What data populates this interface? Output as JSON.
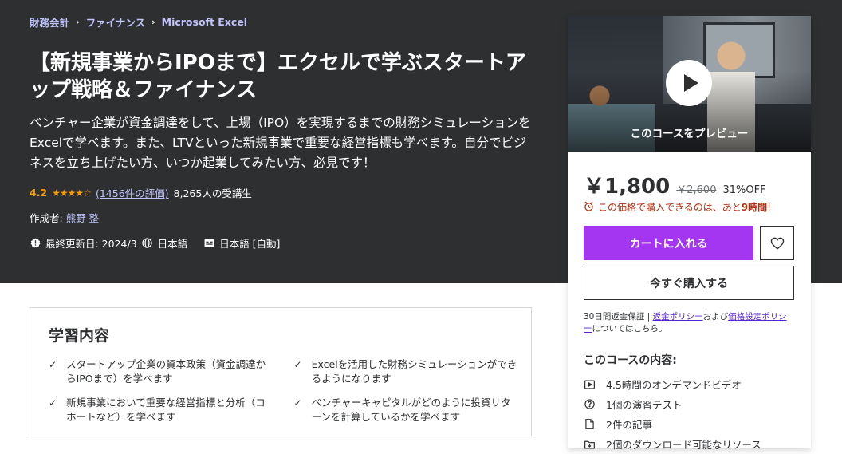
{
  "breadcrumb": [
    "財務会計",
    "ファイナンス",
    "Microsoft Excel"
  ],
  "course": {
    "title": "【新規事業からIPOまで】エクセルで学ぶスタートアップ戦略＆ファイナンス",
    "subtitle": "ベンチャー企業が資金調達をして、上場（IPO）を実現するまでの財務シミュレーションをExcelで学べます。また、LTVといった新規事業で重要な経営指標も学べます。自分でビジネスを立ち上げたい方、いつか起業してみたい方、必見です！",
    "rating": "4.2",
    "stars": "★★★★☆",
    "rating_count": "(1456件の評価)",
    "students": "8,265人の受講生",
    "author_label": "作成者:",
    "author": "熊野 整",
    "last_updated": "最終更新日: 2024/3",
    "language": "日本語",
    "captions": "日本語 [自動]"
  },
  "learn": {
    "title": "学習内容",
    "items": [
      "スタートアップ企業の資本政策（資金調達からIPOまで）を学べます",
      "Excelを活用した財務シミュレーションができるようになります",
      "新規事業において重要な経営指標と分析（コホートなど）を学べます",
      "ベンチャーキャピタルがどのように投資リターンを計算しているかを学べます"
    ]
  },
  "sidebar": {
    "preview_label": "このコースをプレビュー",
    "price": "￥1,800",
    "original_price": "￥2,600",
    "discount": "31%OFF",
    "timer_prefix": "この価格で購入できるのは、あと",
    "timer_value": "9時間",
    "timer_suffix": "!",
    "cart_label": "カートに入れる",
    "buy_label": "今すぐ購入する",
    "guarantee_text": "30日間返金保証 | ",
    "refund_link": "返金ポリシー",
    "and_text": "および",
    "pricing_link": "価格設定ポリシー",
    "about_text": "についてはこちら。",
    "includes_title": "このコースの内容:",
    "includes": [
      {
        "icon": "video-icon",
        "label": "4.5時間のオンデマンドビデオ"
      },
      {
        "icon": "quiz-icon",
        "label": "1個の演習テスト"
      },
      {
        "icon": "article-icon",
        "label": "2件の記事"
      },
      {
        "icon": "download-icon",
        "label": "2個のダウンロード可能なリソース"
      }
    ]
  },
  "colors": {
    "hero_bg": "#2d2f31",
    "accent_purple": "#a435f0",
    "link_light": "#c0c4fc",
    "star": "#f69c08",
    "timer_red": "#b32d0f"
  }
}
